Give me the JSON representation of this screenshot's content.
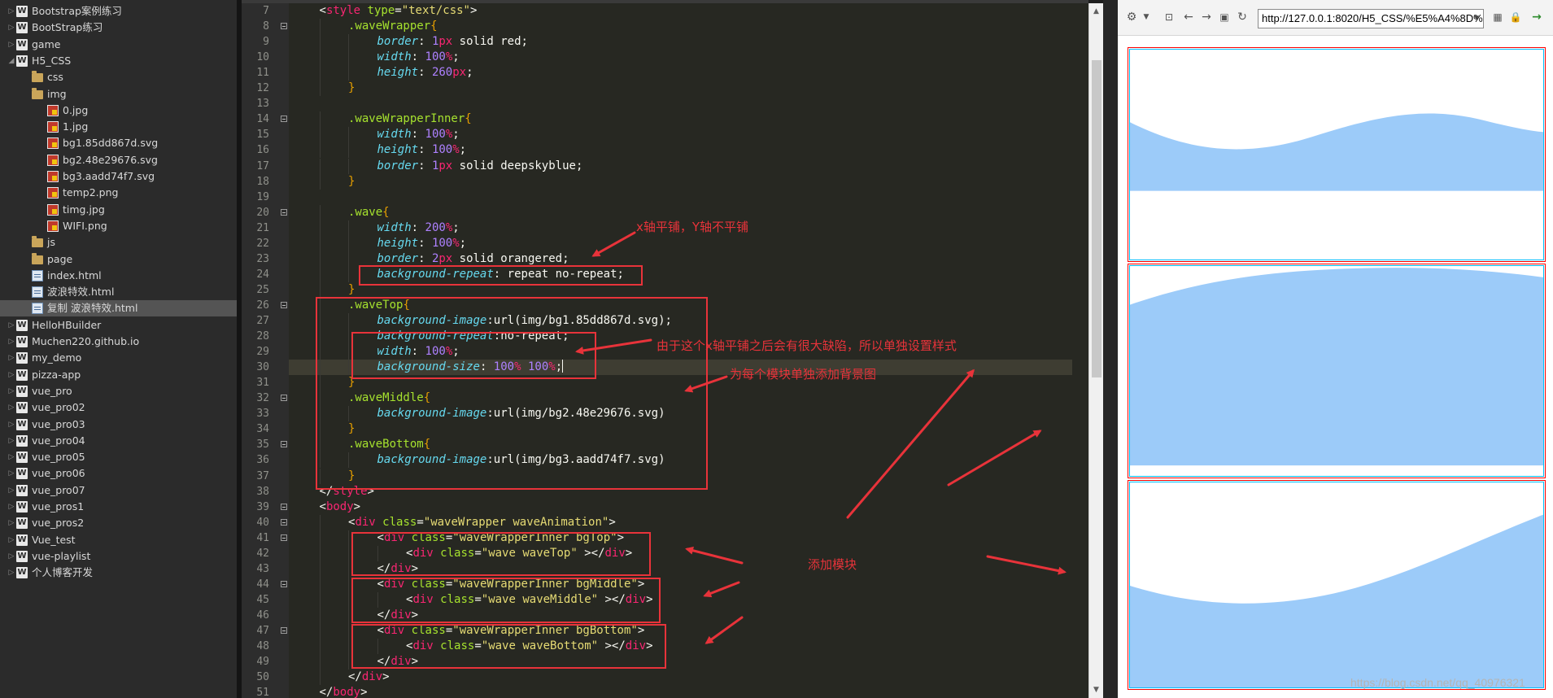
{
  "sidebar": {
    "items": [
      {
        "label": "Bootstrap案例练习",
        "type": "project",
        "indent": 0,
        "expanded": false
      },
      {
        "label": "BootStrap练习",
        "type": "project",
        "indent": 0,
        "expanded": false
      },
      {
        "label": "game",
        "type": "project",
        "indent": 0,
        "expanded": false
      },
      {
        "label": "H5_CSS",
        "type": "project",
        "indent": 0,
        "expanded": true
      },
      {
        "label": "css",
        "type": "folder",
        "indent": 1,
        "expanded": false
      },
      {
        "label": "img",
        "type": "folder",
        "indent": 1,
        "expanded": true
      },
      {
        "label": "0.jpg",
        "type": "image",
        "indent": 2
      },
      {
        "label": "1.jpg",
        "type": "image",
        "indent": 2
      },
      {
        "label": "bg1.85dd867d.svg",
        "type": "image",
        "indent": 2
      },
      {
        "label": "bg2.48e29676.svg",
        "type": "image",
        "indent": 2
      },
      {
        "label": "bg3.aadd74f7.svg",
        "type": "image",
        "indent": 2
      },
      {
        "label": "temp2.png",
        "type": "image",
        "indent": 2
      },
      {
        "label": "timg.jpg",
        "type": "image",
        "indent": 2
      },
      {
        "label": "WIFI.png",
        "type": "image",
        "indent": 2
      },
      {
        "label": "js",
        "type": "folder",
        "indent": 1,
        "expanded": false
      },
      {
        "label": "page",
        "type": "folder",
        "indent": 1,
        "expanded": false
      },
      {
        "label": "index.html",
        "type": "html",
        "indent": 1
      },
      {
        "label": "波浪特效.html",
        "type": "html",
        "indent": 1
      },
      {
        "label": "复制 波浪特效.html",
        "type": "html",
        "indent": 1,
        "selected": true
      },
      {
        "label": "HelloHBuilder",
        "type": "project",
        "indent": 0,
        "expanded": false
      },
      {
        "label": "Muchen220.github.io",
        "type": "project",
        "indent": 0,
        "expanded": false
      },
      {
        "label": "my_demo",
        "type": "project",
        "indent": 0,
        "expanded": false
      },
      {
        "label": "pizza-app",
        "type": "project",
        "indent": 0,
        "expanded": false
      },
      {
        "label": "vue_pro",
        "type": "project",
        "indent": 0,
        "expanded": false
      },
      {
        "label": "vue_pro02",
        "type": "project",
        "indent": 0,
        "expanded": false
      },
      {
        "label": "vue_pro03",
        "type": "project",
        "indent": 0,
        "expanded": false
      },
      {
        "label": "vue_pro04",
        "type": "project",
        "indent": 0,
        "expanded": false
      },
      {
        "label": "vue_pro05",
        "type": "project",
        "indent": 0,
        "expanded": false
      },
      {
        "label": "vue_pro06",
        "type": "project",
        "indent": 0,
        "expanded": false
      },
      {
        "label": "vue_pro07",
        "type": "project",
        "indent": 0,
        "expanded": false
      },
      {
        "label": "vue_pros1",
        "type": "project",
        "indent": 0,
        "expanded": false
      },
      {
        "label": "vue_pros2",
        "type": "project",
        "indent": 0,
        "expanded": false
      },
      {
        "label": "Vue_test",
        "type": "project",
        "indent": 0,
        "expanded": false
      },
      {
        "label": "vue-playlist",
        "type": "project",
        "indent": 0,
        "expanded": false
      },
      {
        "label": "个人博客开发",
        "type": "project",
        "indent": 0,
        "expanded": false
      }
    ]
  },
  "editor": {
    "current_line": 30,
    "fold_lines": [
      8,
      14,
      20,
      26,
      32,
      35,
      39,
      40,
      41,
      44,
      47
    ],
    "lines": [
      {
        "n": 7,
        "i": 1,
        "t": [
          [
            "tag-open",
            "<"
          ],
          [
            "tag",
            "style"
          ],
          [
            "pun",
            " "
          ],
          [
            "attr",
            "type"
          ],
          [
            "pun",
            "="
          ],
          [
            "str",
            "\"text/css\""
          ],
          [
            "pun",
            ">"
          ]
        ]
      },
      {
        "n": 8,
        "i": 2,
        "t": [
          [
            "sel",
            ".waveWrapper"
          ],
          [
            "brace",
            "{"
          ]
        ]
      },
      {
        "n": 9,
        "i": 3,
        "t": [
          [
            "prop",
            "border"
          ],
          [
            "pun",
            ": "
          ],
          [
            "num",
            "1"
          ],
          [
            "unit",
            "px"
          ],
          [
            "val",
            " solid red;"
          ]
        ]
      },
      {
        "n": 10,
        "i": 3,
        "t": [
          [
            "prop",
            "width"
          ],
          [
            "pun",
            ": "
          ],
          [
            "num",
            "100"
          ],
          [
            "unit",
            "%"
          ],
          [
            "pun",
            ";"
          ]
        ]
      },
      {
        "n": 11,
        "i": 3,
        "t": [
          [
            "prop",
            "height"
          ],
          [
            "pun",
            ": "
          ],
          [
            "num",
            "260"
          ],
          [
            "unit",
            "px"
          ],
          [
            "pun",
            ";"
          ]
        ]
      },
      {
        "n": 12,
        "i": 2,
        "t": [
          [
            "brace",
            "}"
          ]
        ]
      },
      {
        "n": 13,
        "i": 0,
        "t": []
      },
      {
        "n": 14,
        "i": 2,
        "t": [
          [
            "sel",
            ".waveWrapperInner"
          ],
          [
            "brace",
            "{"
          ]
        ]
      },
      {
        "n": 15,
        "i": 3,
        "t": [
          [
            "prop",
            "width"
          ],
          [
            "pun",
            ": "
          ],
          [
            "num",
            "100"
          ],
          [
            "unit",
            "%"
          ],
          [
            "pun",
            ";"
          ]
        ]
      },
      {
        "n": 16,
        "i": 3,
        "t": [
          [
            "prop",
            "height"
          ],
          [
            "pun",
            ": "
          ],
          [
            "num",
            "100"
          ],
          [
            "unit",
            "%"
          ],
          [
            "pun",
            ";"
          ]
        ]
      },
      {
        "n": 17,
        "i": 3,
        "t": [
          [
            "prop",
            "border"
          ],
          [
            "pun",
            ": "
          ],
          [
            "num",
            "1"
          ],
          [
            "unit",
            "px"
          ],
          [
            "val",
            " solid deepskyblue;"
          ]
        ]
      },
      {
        "n": 18,
        "i": 2,
        "t": [
          [
            "brace",
            "}"
          ]
        ]
      },
      {
        "n": 19,
        "i": 0,
        "t": []
      },
      {
        "n": 20,
        "i": 2,
        "t": [
          [
            "sel",
            ".wave"
          ],
          [
            "brace",
            "{"
          ]
        ]
      },
      {
        "n": 21,
        "i": 3,
        "t": [
          [
            "prop",
            "width"
          ],
          [
            "pun",
            ": "
          ],
          [
            "num",
            "200"
          ],
          [
            "unit",
            "%"
          ],
          [
            "pun",
            ";"
          ]
        ]
      },
      {
        "n": 22,
        "i": 3,
        "t": [
          [
            "prop",
            "height"
          ],
          [
            "pun",
            ": "
          ],
          [
            "num",
            "100"
          ],
          [
            "unit",
            "%"
          ],
          [
            "pun",
            ";"
          ]
        ]
      },
      {
        "n": 23,
        "i": 3,
        "t": [
          [
            "prop",
            "border"
          ],
          [
            "pun",
            ": "
          ],
          [
            "num",
            "2"
          ],
          [
            "unit",
            "px"
          ],
          [
            "val",
            " solid orangered;"
          ]
        ]
      },
      {
        "n": 24,
        "i": 3,
        "t": [
          [
            "prop",
            "background-repeat"
          ],
          [
            "pun",
            ": "
          ],
          [
            "val",
            "repeat no-repeat;"
          ]
        ]
      },
      {
        "n": 25,
        "i": 2,
        "t": [
          [
            "brace",
            "}"
          ]
        ]
      },
      {
        "n": 26,
        "i": 2,
        "t": [
          [
            "sel",
            ".waveTop"
          ],
          [
            "brace",
            "{"
          ]
        ]
      },
      {
        "n": 27,
        "i": 3,
        "t": [
          [
            "prop",
            "background-image"
          ],
          [
            "pun",
            ":"
          ],
          [
            "val",
            "url(img/bg1.85dd867d.svg);"
          ]
        ]
      },
      {
        "n": 28,
        "i": 3,
        "t": [
          [
            "prop",
            "background-repeat"
          ],
          [
            "pun",
            ":"
          ],
          [
            "val",
            "no-repeat;"
          ]
        ]
      },
      {
        "n": 29,
        "i": 3,
        "t": [
          [
            "prop",
            "width"
          ],
          [
            "pun",
            ": "
          ],
          [
            "num",
            "100"
          ],
          [
            "unit",
            "%"
          ],
          [
            "pun",
            ";"
          ]
        ]
      },
      {
        "n": 30,
        "i": 3,
        "t": [
          [
            "prop",
            "background-size"
          ],
          [
            "pun",
            ": "
          ],
          [
            "num",
            "100"
          ],
          [
            "unit",
            "%"
          ],
          [
            "pun",
            " "
          ],
          [
            "num",
            "100"
          ],
          [
            "unit",
            "%"
          ],
          [
            "pun",
            ";"
          ]
        ]
      },
      {
        "n": 31,
        "i": 2,
        "t": [
          [
            "brace",
            "}"
          ]
        ]
      },
      {
        "n": 32,
        "i": 2,
        "t": [
          [
            "sel",
            ".waveMiddle"
          ],
          [
            "brace",
            "{"
          ]
        ]
      },
      {
        "n": 33,
        "i": 3,
        "t": [
          [
            "prop",
            "background-image"
          ],
          [
            "pun",
            ":"
          ],
          [
            "val",
            "url(img/bg2.48e29676.svg)"
          ]
        ]
      },
      {
        "n": 34,
        "i": 2,
        "t": [
          [
            "brace",
            "}"
          ]
        ]
      },
      {
        "n": 35,
        "i": 2,
        "t": [
          [
            "sel",
            ".waveBottom"
          ],
          [
            "brace",
            "{"
          ]
        ]
      },
      {
        "n": 36,
        "i": 3,
        "t": [
          [
            "prop",
            "background-image"
          ],
          [
            "pun",
            ":"
          ],
          [
            "val",
            "url(img/bg3.aadd74f7.svg)"
          ]
        ]
      },
      {
        "n": 37,
        "i": 2,
        "t": [
          [
            "brace",
            "}"
          ]
        ]
      },
      {
        "n": 38,
        "i": 1,
        "t": [
          [
            "pun",
            "</"
          ],
          [
            "tag",
            "style"
          ],
          [
            "pun",
            ">"
          ]
        ]
      },
      {
        "n": 39,
        "i": 1,
        "t": [
          [
            "pun",
            "<"
          ],
          [
            "tag",
            "body"
          ],
          [
            "pun",
            ">"
          ]
        ]
      },
      {
        "n": 40,
        "i": 2,
        "t": [
          [
            "pun",
            "<"
          ],
          [
            "tag",
            "div"
          ],
          [
            "pun",
            " "
          ],
          [
            "attr",
            "class"
          ],
          [
            "pun",
            "="
          ],
          [
            "str",
            "\"waveWrapper waveAnimation\""
          ],
          [
            "pun",
            ">"
          ]
        ]
      },
      {
        "n": 41,
        "i": 3,
        "t": [
          [
            "pun",
            "<"
          ],
          [
            "tag",
            "div"
          ],
          [
            "pun",
            " "
          ],
          [
            "attr",
            "class"
          ],
          [
            "pun",
            "="
          ],
          [
            "str",
            "\"waveWrapperInner bgTop\""
          ],
          [
            "pun",
            ">"
          ]
        ]
      },
      {
        "n": 42,
        "i": 4,
        "t": [
          [
            "pun",
            "<"
          ],
          [
            "tag",
            "div"
          ],
          [
            "pun",
            " "
          ],
          [
            "attr",
            "class"
          ],
          [
            "pun",
            "="
          ],
          [
            "str",
            "\"wave waveTop\""
          ],
          [
            "pun",
            " ></"
          ],
          [
            "tag",
            "div"
          ],
          [
            "pun",
            ">"
          ]
        ]
      },
      {
        "n": 43,
        "i": 3,
        "t": [
          [
            "pun",
            "</"
          ],
          [
            "tag",
            "div"
          ],
          [
            "pun",
            ">"
          ]
        ]
      },
      {
        "n": 44,
        "i": 3,
        "t": [
          [
            "pun",
            "<"
          ],
          [
            "tag",
            "div"
          ],
          [
            "pun",
            " "
          ],
          [
            "attr",
            "class"
          ],
          [
            "pun",
            "="
          ],
          [
            "str",
            "\"waveWrapperInner bgMiddle\""
          ],
          [
            "pun",
            ">"
          ]
        ]
      },
      {
        "n": 45,
        "i": 4,
        "t": [
          [
            "pun",
            "<"
          ],
          [
            "tag",
            "div"
          ],
          [
            "pun",
            " "
          ],
          [
            "attr",
            "class"
          ],
          [
            "pun",
            "="
          ],
          [
            "str",
            "\"wave waveMiddle\""
          ],
          [
            "pun",
            " ></"
          ],
          [
            "tag",
            "div"
          ],
          [
            "pun",
            ">"
          ]
        ]
      },
      {
        "n": 46,
        "i": 3,
        "t": [
          [
            "pun",
            "</"
          ],
          [
            "tag",
            "div"
          ],
          [
            "pun",
            ">"
          ]
        ]
      },
      {
        "n": 47,
        "i": 3,
        "t": [
          [
            "pun",
            "<"
          ],
          [
            "tag",
            "div"
          ],
          [
            "pun",
            " "
          ],
          [
            "attr",
            "class"
          ],
          [
            "pun",
            "="
          ],
          [
            "str",
            "\"waveWrapperInner bgBottom\""
          ],
          [
            "pun",
            ">"
          ]
        ]
      },
      {
        "n": 48,
        "i": 4,
        "t": [
          [
            "pun",
            "<"
          ],
          [
            "tag",
            "div"
          ],
          [
            "pun",
            " "
          ],
          [
            "attr",
            "class"
          ],
          [
            "pun",
            "="
          ],
          [
            "str",
            "\"wave waveBottom\""
          ],
          [
            "pun",
            " ></"
          ],
          [
            "tag",
            "div"
          ],
          [
            "pun",
            ">"
          ]
        ]
      },
      {
        "n": 49,
        "i": 3,
        "t": [
          [
            "pun",
            "</"
          ],
          [
            "tag",
            "div"
          ],
          [
            "pun",
            ">"
          ]
        ]
      },
      {
        "n": 50,
        "i": 2,
        "t": [
          [
            "pun",
            "</"
          ],
          [
            "tag",
            "div"
          ],
          [
            "pun",
            ">"
          ]
        ]
      },
      {
        "n": 51,
        "i": 1,
        "t": [
          [
            "pun",
            "</"
          ],
          [
            "tag",
            "body"
          ],
          [
            "pun",
            ">"
          ]
        ]
      }
    ]
  },
  "annotations": {
    "x_repeat_note": "x轴平铺，Y轴不平铺",
    "defect_note": "由于这个x轴平铺之后会有很大缺陷，所以单独设置样式",
    "bg_note": "为每个模块单独添加背景图",
    "add_module_note": "添加模块",
    "color": "#e8333a"
  },
  "browser": {
    "url": "http://127.0.0.1:8020/H5_CSS/%E5%A4%8D%",
    "wave_color": "#9ccbf9",
    "outer_border_color": "#ff0000",
    "inner_border_color": "#00bfff"
  },
  "watermark": "https://blog.csdn.net/qq_40976321",
  "icons": {
    "gear": "gear-icon",
    "back": "back-arrow-icon",
    "forward": "forward-arrow-icon",
    "refresh": "refresh-icon",
    "lock": "lock-icon",
    "go": "go-arrow-icon"
  }
}
